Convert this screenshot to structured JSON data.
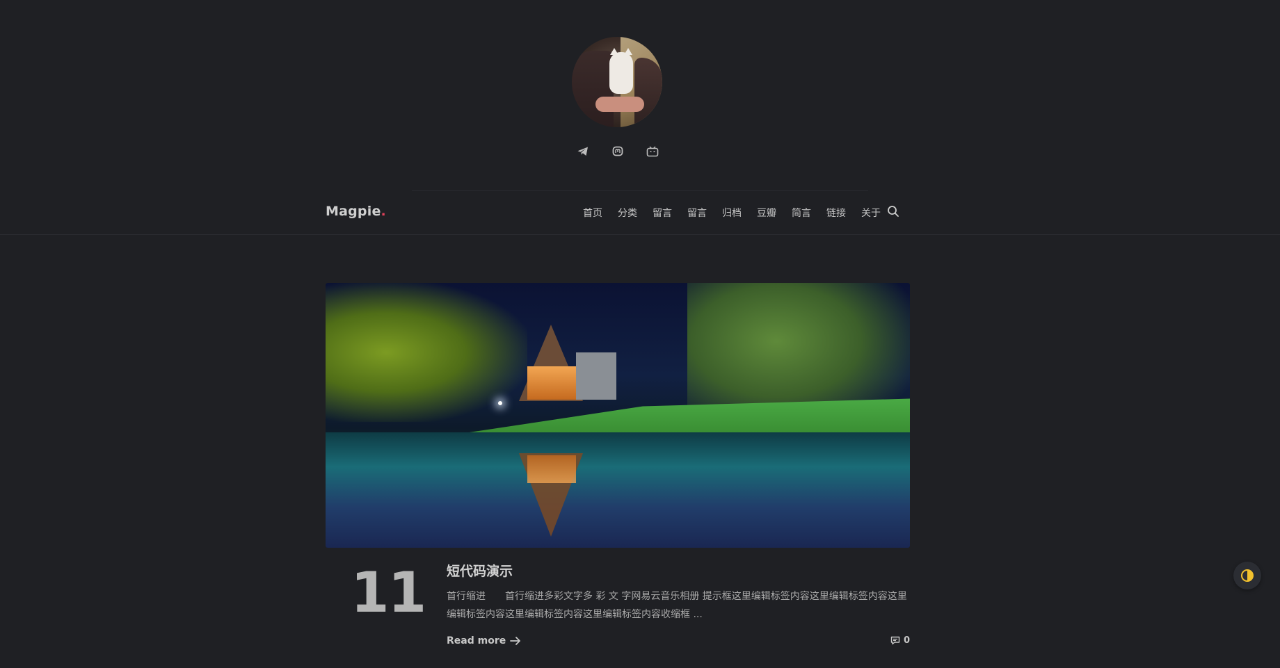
{
  "site": {
    "brand": "Magpie",
    "brand_dot": "."
  },
  "social": [
    {
      "icon": "telegram-icon"
    },
    {
      "icon": "mastodon-icon"
    },
    {
      "icon": "bilibili-icon"
    }
  ],
  "nav": {
    "items": [
      "首页",
      "分类",
      "留言",
      "留言",
      "归档",
      "豆瓣",
      "简言",
      "链接",
      "关于"
    ],
    "search_icon": "search-icon"
  },
  "post": {
    "day": "11",
    "title": "短代码演示",
    "excerpt": "首行缩进　　首行缩进多彩文字多 彩 文 字网易云音乐相册 提示框这里编辑标签内容这里编辑标签内容这里编辑标签内容这里编辑标签内容这里编辑标签内容收缩框 ...",
    "read_more": "Read more",
    "comments": "0"
  },
  "colors": {
    "background": "#1f2024",
    "brand_dot": "#e0415a",
    "toggle_accent": "#f2c12e"
  }
}
